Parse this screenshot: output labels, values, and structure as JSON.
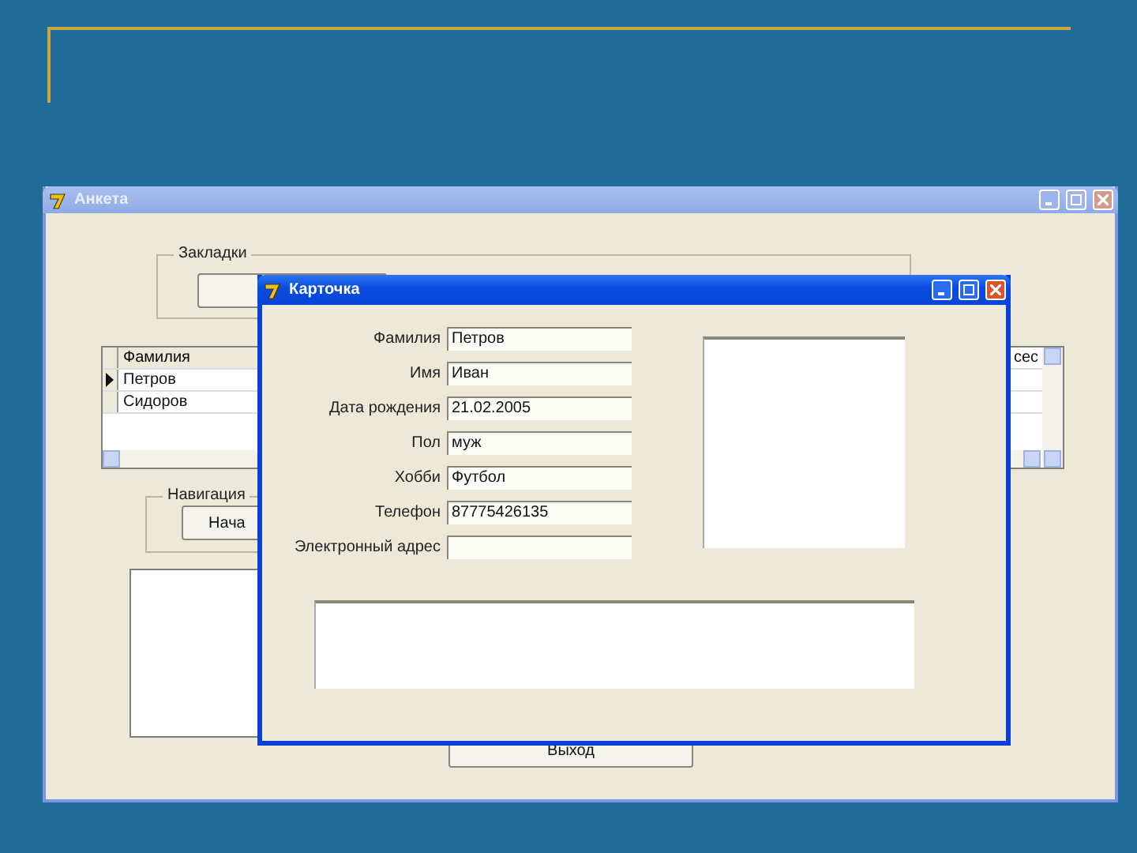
{
  "main_window": {
    "title": "Анкета",
    "bookmarks_group": {
      "title": "Закладки"
    },
    "grid": {
      "columns": [
        "Фамилия",
        "сес"
      ],
      "rows": [
        {
          "cells": [
            "Петров"
          ],
          "selected": true
        },
        {
          "cells": [
            "Сидоров"
          ],
          "selected": false
        }
      ]
    },
    "navigation_group": {
      "title": "Навигация",
      "button": "Нача"
    },
    "exit_button": "Выход"
  },
  "card_window": {
    "title": "Карточка",
    "fields": [
      {
        "label": "Фамилия",
        "value": "Петров"
      },
      {
        "label": "Имя",
        "value": "Иван"
      },
      {
        "label": "Дата рождения",
        "value": "21.02.2005"
      },
      {
        "label": "Пол",
        "value": "муж"
      },
      {
        "label": "Хобби",
        "value": "Футбол"
      },
      {
        "label": "Телефон",
        "value": "87775426135"
      },
      {
        "label": "Электронный адрес"
      }
    ]
  }
}
